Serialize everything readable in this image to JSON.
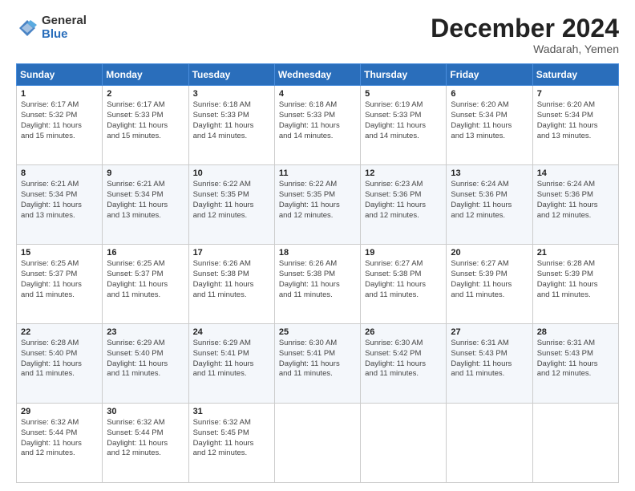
{
  "header": {
    "logo_general": "General",
    "logo_blue": "Blue",
    "month_title": "December 2024",
    "location": "Wadarah, Yemen"
  },
  "days_of_week": [
    "Sunday",
    "Monday",
    "Tuesday",
    "Wednesday",
    "Thursday",
    "Friday",
    "Saturday"
  ],
  "weeks": [
    [
      {
        "day": 1,
        "lines": [
          "Sunrise: 6:17 AM",
          "Sunset: 5:32 PM",
          "Daylight: 11 hours",
          "and 15 minutes."
        ]
      },
      {
        "day": 2,
        "lines": [
          "Sunrise: 6:17 AM",
          "Sunset: 5:33 PM",
          "Daylight: 11 hours",
          "and 15 minutes."
        ]
      },
      {
        "day": 3,
        "lines": [
          "Sunrise: 6:18 AM",
          "Sunset: 5:33 PM",
          "Daylight: 11 hours",
          "and 14 minutes."
        ]
      },
      {
        "day": 4,
        "lines": [
          "Sunrise: 6:18 AM",
          "Sunset: 5:33 PM",
          "Daylight: 11 hours",
          "and 14 minutes."
        ]
      },
      {
        "day": 5,
        "lines": [
          "Sunrise: 6:19 AM",
          "Sunset: 5:33 PM",
          "Daylight: 11 hours",
          "and 14 minutes."
        ]
      },
      {
        "day": 6,
        "lines": [
          "Sunrise: 6:20 AM",
          "Sunset: 5:34 PM",
          "Daylight: 11 hours",
          "and 13 minutes."
        ]
      },
      {
        "day": 7,
        "lines": [
          "Sunrise: 6:20 AM",
          "Sunset: 5:34 PM",
          "Daylight: 11 hours",
          "and 13 minutes."
        ]
      }
    ],
    [
      {
        "day": 8,
        "lines": [
          "Sunrise: 6:21 AM",
          "Sunset: 5:34 PM",
          "Daylight: 11 hours",
          "and 13 minutes."
        ]
      },
      {
        "day": 9,
        "lines": [
          "Sunrise: 6:21 AM",
          "Sunset: 5:34 PM",
          "Daylight: 11 hours",
          "and 13 minutes."
        ]
      },
      {
        "day": 10,
        "lines": [
          "Sunrise: 6:22 AM",
          "Sunset: 5:35 PM",
          "Daylight: 11 hours",
          "and 12 minutes."
        ]
      },
      {
        "day": 11,
        "lines": [
          "Sunrise: 6:22 AM",
          "Sunset: 5:35 PM",
          "Daylight: 11 hours",
          "and 12 minutes."
        ]
      },
      {
        "day": 12,
        "lines": [
          "Sunrise: 6:23 AM",
          "Sunset: 5:36 PM",
          "Daylight: 11 hours",
          "and 12 minutes."
        ]
      },
      {
        "day": 13,
        "lines": [
          "Sunrise: 6:24 AM",
          "Sunset: 5:36 PM",
          "Daylight: 11 hours",
          "and 12 minutes."
        ]
      },
      {
        "day": 14,
        "lines": [
          "Sunrise: 6:24 AM",
          "Sunset: 5:36 PM",
          "Daylight: 11 hours",
          "and 12 minutes."
        ]
      }
    ],
    [
      {
        "day": 15,
        "lines": [
          "Sunrise: 6:25 AM",
          "Sunset: 5:37 PM",
          "Daylight: 11 hours",
          "and 11 minutes."
        ]
      },
      {
        "day": 16,
        "lines": [
          "Sunrise: 6:25 AM",
          "Sunset: 5:37 PM",
          "Daylight: 11 hours",
          "and 11 minutes."
        ]
      },
      {
        "day": 17,
        "lines": [
          "Sunrise: 6:26 AM",
          "Sunset: 5:38 PM",
          "Daylight: 11 hours",
          "and 11 minutes."
        ]
      },
      {
        "day": 18,
        "lines": [
          "Sunrise: 6:26 AM",
          "Sunset: 5:38 PM",
          "Daylight: 11 hours",
          "and 11 minutes."
        ]
      },
      {
        "day": 19,
        "lines": [
          "Sunrise: 6:27 AM",
          "Sunset: 5:38 PM",
          "Daylight: 11 hours",
          "and 11 minutes."
        ]
      },
      {
        "day": 20,
        "lines": [
          "Sunrise: 6:27 AM",
          "Sunset: 5:39 PM",
          "Daylight: 11 hours",
          "and 11 minutes."
        ]
      },
      {
        "day": 21,
        "lines": [
          "Sunrise: 6:28 AM",
          "Sunset: 5:39 PM",
          "Daylight: 11 hours",
          "and 11 minutes."
        ]
      }
    ],
    [
      {
        "day": 22,
        "lines": [
          "Sunrise: 6:28 AM",
          "Sunset: 5:40 PM",
          "Daylight: 11 hours",
          "and 11 minutes."
        ]
      },
      {
        "day": 23,
        "lines": [
          "Sunrise: 6:29 AM",
          "Sunset: 5:40 PM",
          "Daylight: 11 hours",
          "and 11 minutes."
        ]
      },
      {
        "day": 24,
        "lines": [
          "Sunrise: 6:29 AM",
          "Sunset: 5:41 PM",
          "Daylight: 11 hours",
          "and 11 minutes."
        ]
      },
      {
        "day": 25,
        "lines": [
          "Sunrise: 6:30 AM",
          "Sunset: 5:41 PM",
          "Daylight: 11 hours",
          "and 11 minutes."
        ]
      },
      {
        "day": 26,
        "lines": [
          "Sunrise: 6:30 AM",
          "Sunset: 5:42 PM",
          "Daylight: 11 hours",
          "and 11 minutes."
        ]
      },
      {
        "day": 27,
        "lines": [
          "Sunrise: 6:31 AM",
          "Sunset: 5:43 PM",
          "Daylight: 11 hours",
          "and 11 minutes."
        ]
      },
      {
        "day": 28,
        "lines": [
          "Sunrise: 6:31 AM",
          "Sunset: 5:43 PM",
          "Daylight: 11 hours",
          "and 12 minutes."
        ]
      }
    ],
    [
      {
        "day": 29,
        "lines": [
          "Sunrise: 6:32 AM",
          "Sunset: 5:44 PM",
          "Daylight: 11 hours",
          "and 12 minutes."
        ]
      },
      {
        "day": 30,
        "lines": [
          "Sunrise: 6:32 AM",
          "Sunset: 5:44 PM",
          "Daylight: 11 hours",
          "and 12 minutes."
        ]
      },
      {
        "day": 31,
        "lines": [
          "Sunrise: 6:32 AM",
          "Sunset: 5:45 PM",
          "Daylight: 11 hours",
          "and 12 minutes."
        ]
      },
      null,
      null,
      null,
      null
    ]
  ]
}
